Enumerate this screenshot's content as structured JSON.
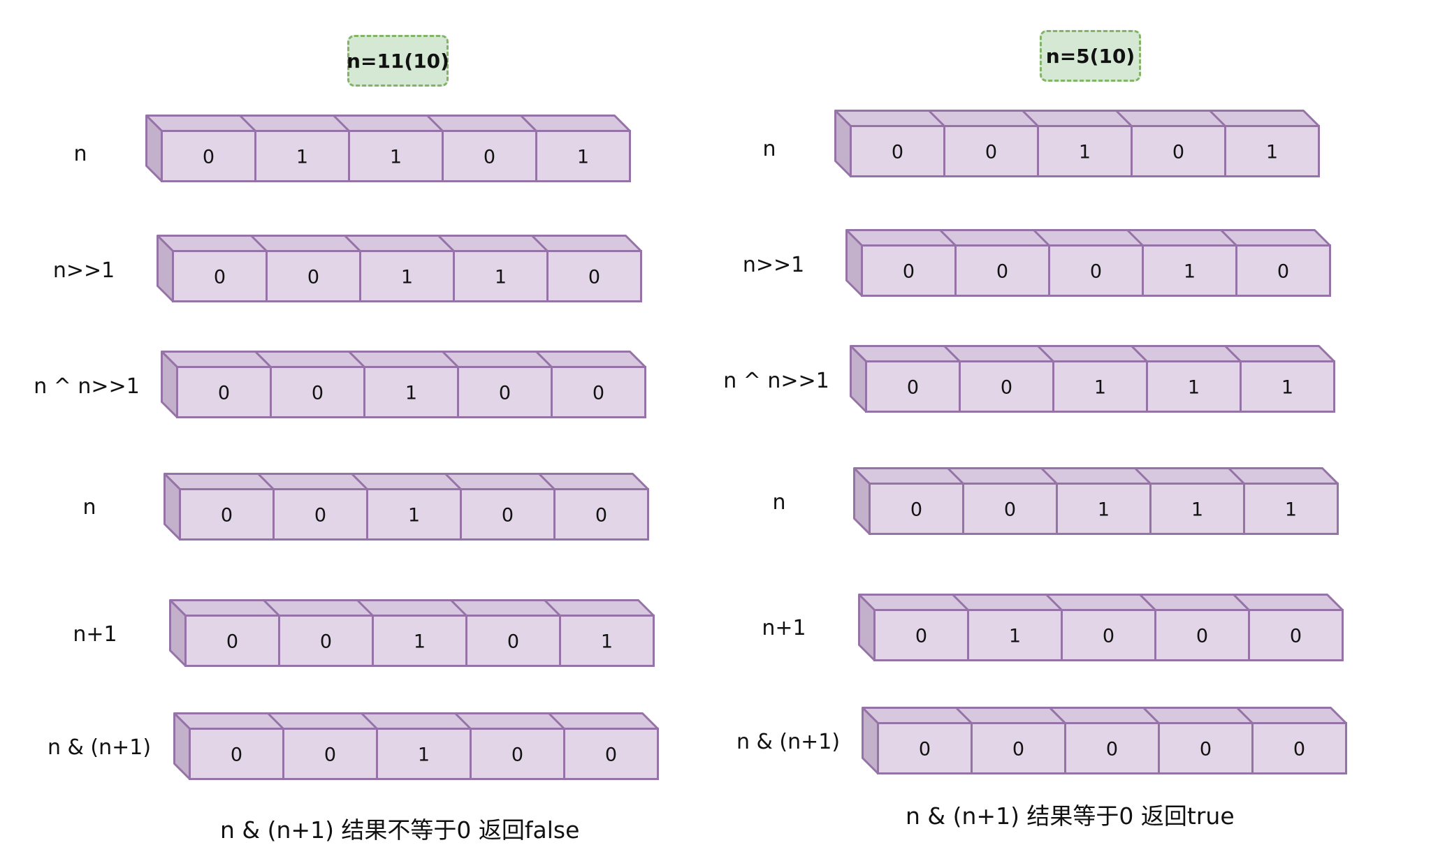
{
  "diagrams": [
    {
      "title": "n=11(10)",
      "rows": [
        {
          "label": "n",
          "bits": [
            "0",
            "1",
            "1",
            "0",
            "1"
          ]
        },
        {
          "label": "n>>1",
          "bits": [
            "0",
            "0",
            "1",
            "1",
            "0"
          ]
        },
        {
          "label": "n ^ n>>1",
          "bits": [
            "0",
            "0",
            "1",
            "0",
            "0"
          ]
        },
        {
          "label": "n",
          "bits": [
            "0",
            "0",
            "1",
            "0",
            "0"
          ]
        },
        {
          "label": "n+1",
          "bits": [
            "0",
            "0",
            "1",
            "0",
            "1"
          ]
        },
        {
          "label": "n & (n+1)",
          "bits": [
            "0",
            "0",
            "1",
            "0",
            "0"
          ]
        }
      ],
      "caption": "n & (n+1)  结果不等于0 返回false"
    },
    {
      "title": "n=5(10)",
      "rows": [
        {
          "label": "n",
          "bits": [
            "0",
            "0",
            "1",
            "0",
            "1"
          ]
        },
        {
          "label": "n>>1",
          "bits": [
            "0",
            "0",
            "0",
            "1",
            "0"
          ]
        },
        {
          "label": "n ^ n>>1",
          "bits": [
            "0",
            "0",
            "1",
            "1",
            "1"
          ]
        },
        {
          "label": "n",
          "bits": [
            "0",
            "0",
            "1",
            "1",
            "1"
          ]
        },
        {
          "label": "n+1",
          "bits": [
            "0",
            "1",
            "0",
            "0",
            "0"
          ]
        },
        {
          "label": "n & (n+1)",
          "bits": [
            "0",
            "0",
            "0",
            "0",
            "0"
          ]
        }
      ],
      "caption": "n & (n+1)  结果等于0 返回true"
    }
  ],
  "colors": {
    "cell_fill": "#e1d5e7",
    "cell_top": "#d7c8df",
    "cell_side": "#c3b1cc",
    "cell_stroke": "#9673a6",
    "title_fill": "#d5e8d4",
    "title_stroke": "#82b366"
  }
}
